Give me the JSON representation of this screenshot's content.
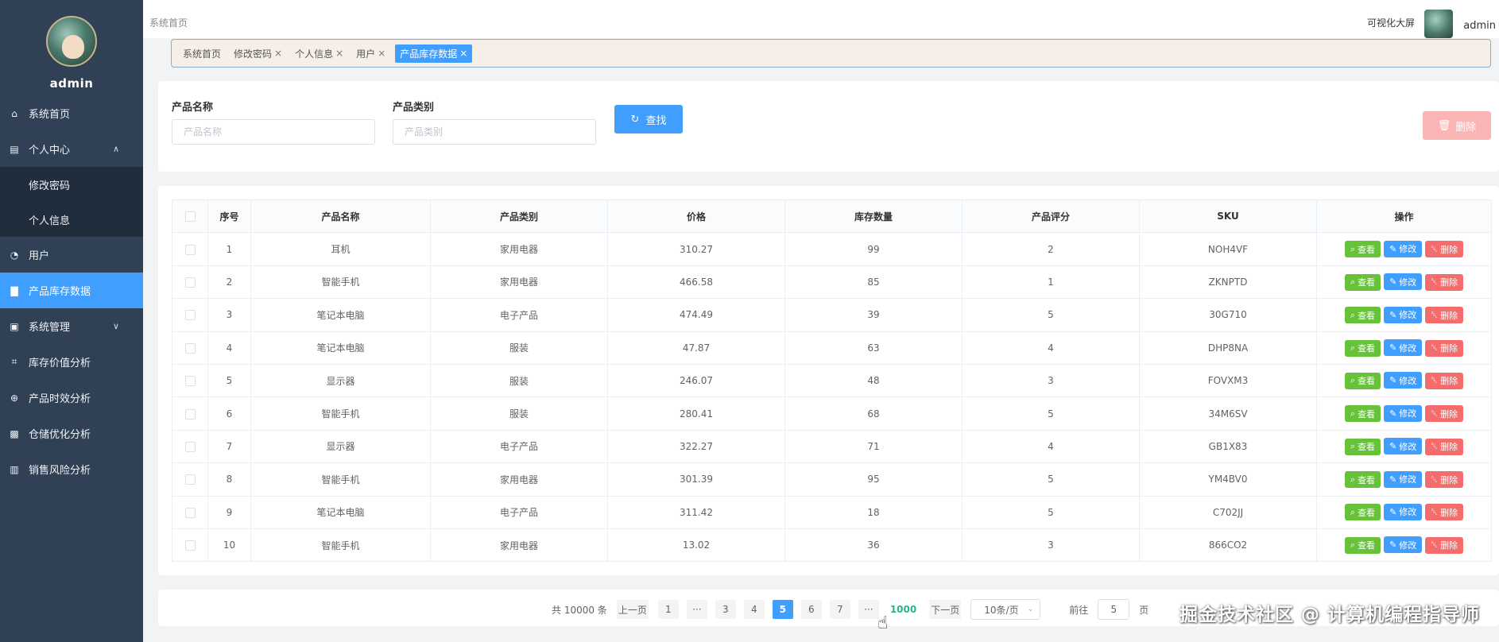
{
  "sidebar": {
    "username": "admin",
    "items": [
      {
        "label": "系统首页",
        "icon": "home-icon"
      },
      {
        "label": "个人中心",
        "icon": "user-card-icon",
        "expanded": true
      },
      {
        "label": "修改密码",
        "sub": true
      },
      {
        "label": "个人信息",
        "sub": true
      },
      {
        "label": "用户",
        "icon": "user-icon"
      },
      {
        "label": "产品库存数据",
        "icon": "bar-chart-icon",
        "active": true
      },
      {
        "label": "系统管理",
        "icon": "clipboard-icon"
      },
      {
        "label": "库存价值分析",
        "icon": "crop-icon"
      },
      {
        "label": "产品时效分析",
        "icon": "compass-icon"
      },
      {
        "label": "仓储优化分析",
        "icon": "line-chart-icon"
      },
      {
        "label": "销售风险分析",
        "icon": "report-icon"
      }
    ]
  },
  "header": {
    "breadcrumb": "系统首页",
    "big_screen": "可视化大屏",
    "user": "admin"
  },
  "tags": [
    "系统首页",
    "修改密码",
    "个人信息",
    "用户",
    "产品库存数据"
  ],
  "search": {
    "name_label": "产品名称",
    "name_placeholder": "产品名称",
    "category_label": "产品类别",
    "category_placeholder": "产品类别",
    "search_button": "查找",
    "delete_button": "删除"
  },
  "table": {
    "headers": [
      "序号",
      "产品名称",
      "产品类别",
      "价格",
      "库存数量",
      "产品评分",
      "SKU",
      "操作"
    ],
    "rows": [
      [
        "1",
        "耳机",
        "家用电器",
        "310.27",
        "99",
        "2",
        "NOH4VF"
      ],
      [
        "2",
        "智能手机",
        "家用电器",
        "466.58",
        "85",
        "1",
        "ZKNPTD"
      ],
      [
        "3",
        "笔记本电脑",
        "电子产品",
        "474.49",
        "39",
        "5",
        "30G710"
      ],
      [
        "4",
        "笔记本电脑",
        "服装",
        "47.87",
        "63",
        "4",
        "DHP8NA"
      ],
      [
        "5",
        "显示器",
        "服装",
        "246.07",
        "48",
        "3",
        "FOVXM3"
      ],
      [
        "6",
        "智能手机",
        "服装",
        "280.41",
        "68",
        "5",
        "34M6SV"
      ],
      [
        "7",
        "显示器",
        "电子产品",
        "322.27",
        "71",
        "4",
        "GB1X83"
      ],
      [
        "8",
        "智能手机",
        "家用电器",
        "301.39",
        "95",
        "5",
        "YM4BV0"
      ],
      [
        "9",
        "笔记本电脑",
        "电子产品",
        "311.42",
        "18",
        "5",
        "C702JJ"
      ],
      [
        "10",
        "智能手机",
        "家用电器",
        "13.02",
        "36",
        "3",
        "866CO2"
      ]
    ],
    "actions": {
      "view": "查看",
      "edit": "修改",
      "delete": "删除"
    }
  },
  "pagination": {
    "total": "共 10000 条",
    "prev": "上一页",
    "next": "下一页",
    "pages": [
      "1",
      "···",
      "3",
      "4",
      "5",
      "6",
      "7",
      "···",
      "1000"
    ],
    "current": "5",
    "hover": "1000",
    "page_size": "10条/页",
    "goto_label": "前往",
    "goto_value": "5",
    "goto_suffix": "页"
  },
  "watermark": "掘金技术社区 @ 计算机编程指导师"
}
